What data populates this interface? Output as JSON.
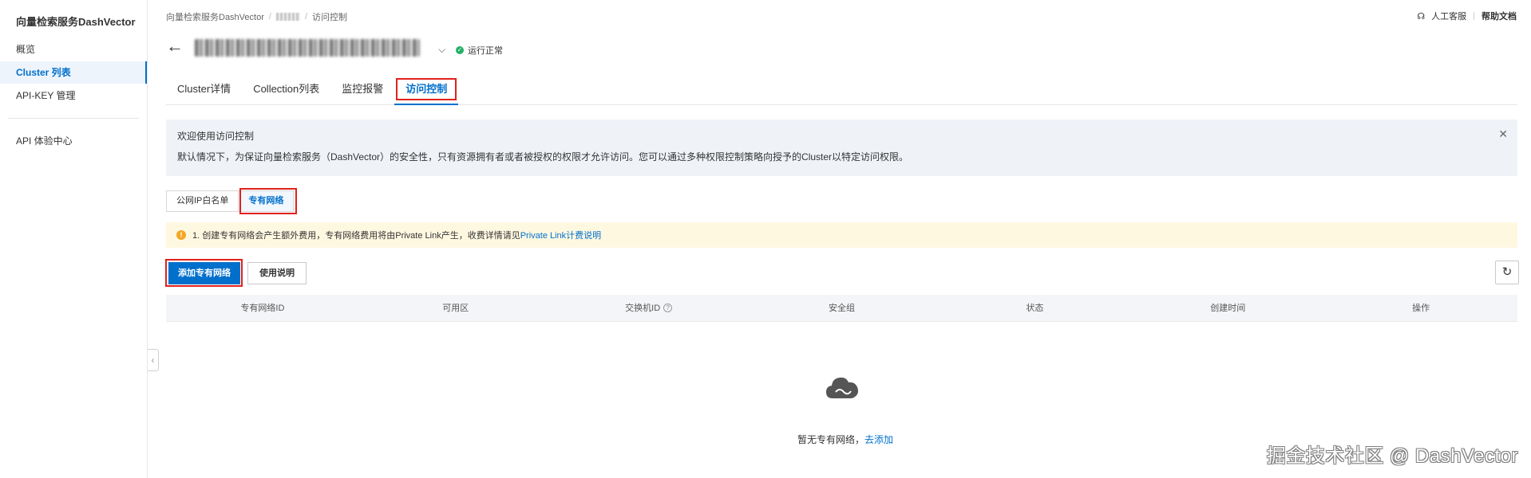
{
  "sidebar": {
    "title": "向量检索服务DashVector",
    "items": [
      {
        "label": "概览"
      },
      {
        "label": "Cluster 列表"
      },
      {
        "label": "API-KEY 管理"
      },
      {
        "label": "API 体验中心"
      }
    ]
  },
  "breadcrumb": {
    "root": "向量检索服务DashVector",
    "current": "访问控制"
  },
  "top_links": {
    "support": "人工客服",
    "help": "帮助文档"
  },
  "header": {
    "status": "运行正常"
  },
  "tabs": [
    {
      "label": "Cluster详情"
    },
    {
      "label": "Collection列表"
    },
    {
      "label": "监控报警"
    },
    {
      "label": "访问控制"
    }
  ],
  "notice": {
    "title": "欢迎使用访问控制",
    "body": "默认情况下，为保证向量检索服务（DashVector）的安全性，只有资源拥有者或者被授权的权限才允许访问。您可以通过多种权限控制策略向授予的Cluster以特定访问权限。"
  },
  "segmented": {
    "public": "公网IP白名单",
    "private": "专有网络"
  },
  "warning": {
    "text": "1. 创建专有网络会产生额外费用，专有网络费用将由Private Link产生，收费详情请见",
    "link": "Private Link计费说明"
  },
  "actions": {
    "add": "添加专有网络",
    "guide": "使用说明"
  },
  "table": {
    "columns": [
      "专有网络ID",
      "可用区",
      "交换机ID",
      "安全组",
      "状态",
      "创建时间",
      "操作"
    ]
  },
  "empty": {
    "text": "暂无专有网络，",
    "link": "去添加"
  },
  "watermark": "掘金技术社区 @ DashVector",
  "colors": {
    "primary": "#0070cc",
    "highlight": "#e0211b",
    "success": "#23b066",
    "warning_bg": "#fff8e1"
  }
}
